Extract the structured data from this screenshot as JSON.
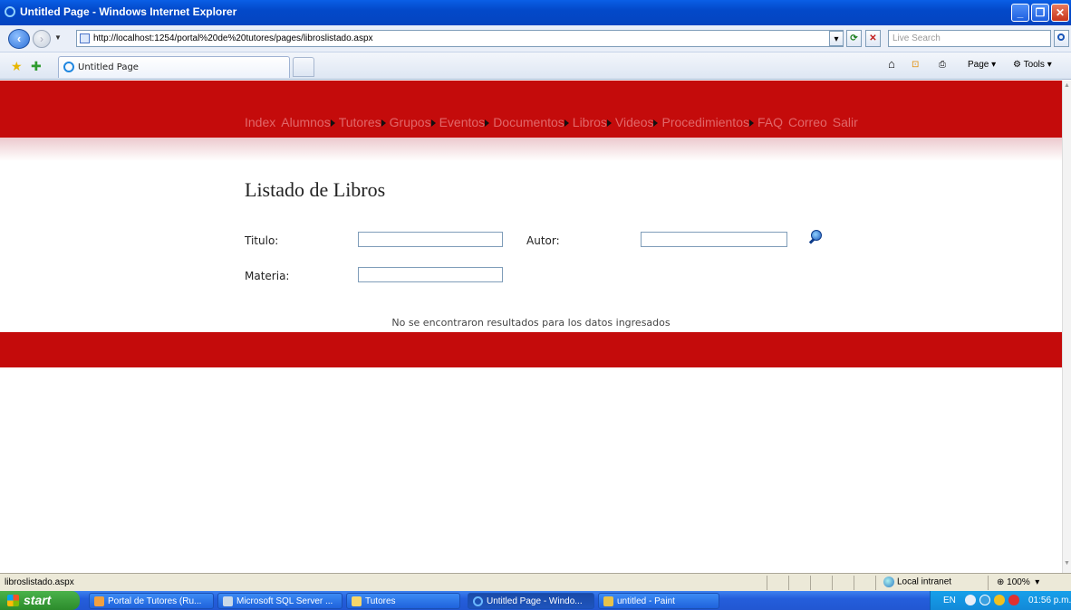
{
  "window": {
    "title": "Untitled Page - Windows Internet Explorer"
  },
  "addressbar": {
    "url": "http://localhost:1254/portal%20de%20tutores/pages/libroslistado.aspx",
    "search_placeholder": "Live Search"
  },
  "tabs": {
    "active_label": "Untitled Page"
  },
  "commandbar": {
    "page_label": "Page",
    "tools_label": "Tools"
  },
  "site": {
    "menu": [
      {
        "label": "Index",
        "submenu": false
      },
      {
        "label": "Alumnos",
        "submenu": true
      },
      {
        "label": "Tutores",
        "submenu": true
      },
      {
        "label": "Grupos",
        "submenu": true
      },
      {
        "label": "Eventos",
        "submenu": true
      },
      {
        "label": "Documentos",
        "submenu": true
      },
      {
        "label": "Libros",
        "submenu": true
      },
      {
        "label": "Videos",
        "submenu": true
      },
      {
        "label": "Procedimientos",
        "submenu": true
      },
      {
        "label": "FAQ",
        "submenu": false
      },
      {
        "label": "Correo",
        "submenu": false
      },
      {
        "label": "Salir",
        "submenu": false
      }
    ],
    "colors": {
      "banner": "#c40b0b",
      "menu_text": "#e1686a"
    }
  },
  "page": {
    "title": "Listado de Libros",
    "titulo_label": "Titulo:",
    "titulo_value": "",
    "autor_label": "Autor:",
    "autor_value": "",
    "materia_label": "Materia:",
    "materia_value": "",
    "no_results": "No se encontraron resultados para los datos ingresados"
  },
  "statusbar": {
    "text": "libroslistado.aspx",
    "zone": "Local intranet",
    "zoom": "100%"
  },
  "taskbar": {
    "start_label": "start",
    "tasks": [
      {
        "label": "Portal de Tutores (Ru...",
        "active": false
      },
      {
        "label": "Microsoft SQL Server ...",
        "active": false
      },
      {
        "label": "Tutores",
        "active": false
      },
      {
        "label": "Untitled Page - Windo...",
        "active": true
      },
      {
        "label": "untitled - Paint",
        "active": false
      }
    ],
    "lang": "EN",
    "clock": "01:56 p.m."
  }
}
